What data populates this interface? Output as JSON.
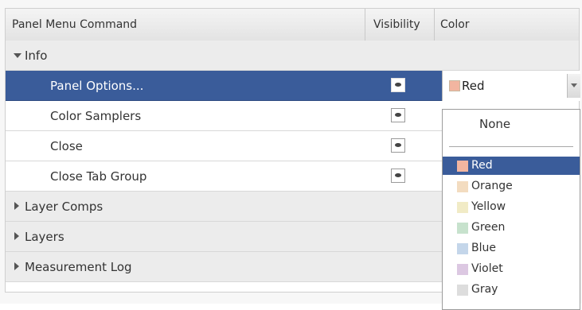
{
  "header": {
    "col1": "Panel Menu Command",
    "col2": "Visibility",
    "col3": "Color"
  },
  "rows": [
    {
      "label": "Info",
      "type": "group",
      "expanded": true
    },
    {
      "label": "Panel Options...",
      "type": "child",
      "selected": true,
      "color": "Red"
    },
    {
      "label": "Color Samplers",
      "type": "child"
    },
    {
      "label": "Close",
      "type": "child"
    },
    {
      "label": "Close Tab Group",
      "type": "child"
    },
    {
      "label": "Layer Comps",
      "type": "group",
      "expanded": false
    },
    {
      "label": "Layers",
      "type": "group",
      "expanded": false
    },
    {
      "label": "Measurement Log",
      "type": "group",
      "expanded": false
    }
  ],
  "color_select": {
    "value": "Red",
    "swatch": "#f2b5a0"
  },
  "dropdown": {
    "none_label": "None",
    "options": [
      {
        "label": "Red",
        "swatch": "#f2b5a0",
        "selected": true
      },
      {
        "label": "Orange",
        "swatch": "#f3dcc0"
      },
      {
        "label": "Yellow",
        "swatch": "#f1ebc6"
      },
      {
        "label": "Green",
        "swatch": "#c7e2cd"
      },
      {
        "label": "Blue",
        "swatch": "#c4d6ea"
      },
      {
        "label": "Violet",
        "swatch": "#dcc8e2"
      },
      {
        "label": "Gray",
        "swatch": "#dddddd"
      }
    ]
  }
}
